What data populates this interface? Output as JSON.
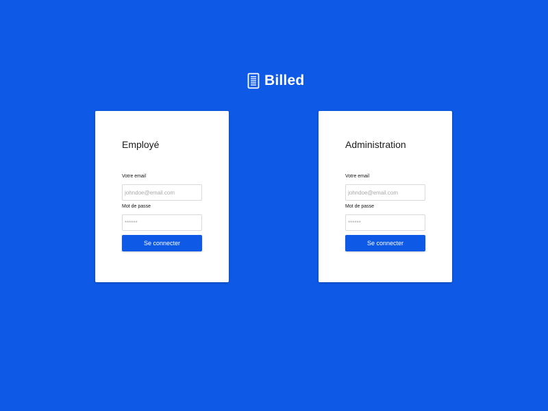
{
  "brand": {
    "name": "Billed",
    "icon": "receipt-icon"
  },
  "colors": {
    "background": "#0e5ae6",
    "card": "#ffffff",
    "button": "#0e5ae6"
  },
  "employee_form": {
    "title": "Employé",
    "email_label": "Votre email",
    "email_value": "",
    "email_placeholder": "johndoe@email.com",
    "password_label": "Mot de passe",
    "password_value": "",
    "password_placeholder": "******",
    "submit_label": "Se connecter"
  },
  "admin_form": {
    "title": "Administration",
    "email_label": "Votre email",
    "email_value": "",
    "email_placeholder": "johndoe@email.com",
    "password_label": "Mot de passe",
    "password_value": "",
    "password_placeholder": "******",
    "submit_label": "Se connecter"
  }
}
